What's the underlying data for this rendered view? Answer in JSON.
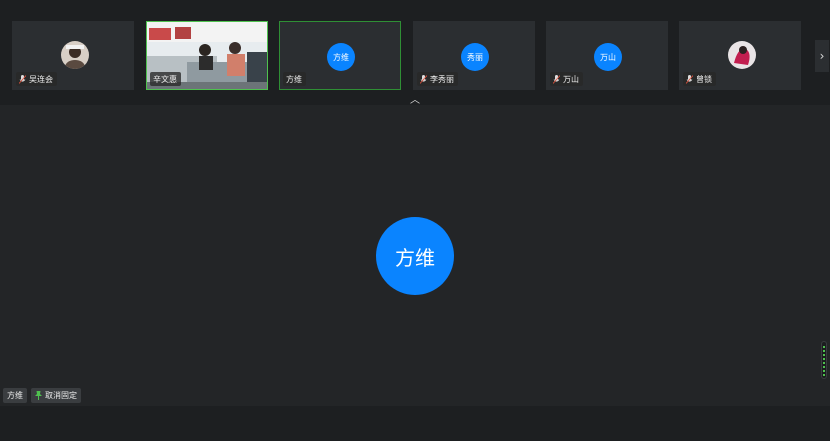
{
  "participants": [
    {
      "name": "吴连会",
      "avatar": "photo",
      "muted_icon": "mic-icon"
    },
    {
      "name": "辛文惠",
      "avatar": "video"
    },
    {
      "name": "方维",
      "avatar_text": "方维",
      "active": true
    },
    {
      "name": "李秀丽",
      "avatar_text": "秀丽",
      "muted_icon": "mic-icon"
    },
    {
      "name": "万山",
      "avatar_text": "万山",
      "muted_icon": "mic-icon"
    },
    {
      "name": "曾锁",
      "avatar": "photo",
      "muted_icon": "mic-icon"
    }
  ],
  "main": {
    "avatar_text": "方维",
    "name": "方维",
    "unpin_label": "取消固定"
  },
  "colors": {
    "accent": "#0a84ff",
    "active_border": "#2f8f35",
    "video_border": "#4fc14f",
    "pin_icon": "#4fc14f"
  },
  "icons": {
    "next": "chevron-right-icon",
    "collapse": "chevron-up-icon",
    "pin": "pin-icon"
  }
}
